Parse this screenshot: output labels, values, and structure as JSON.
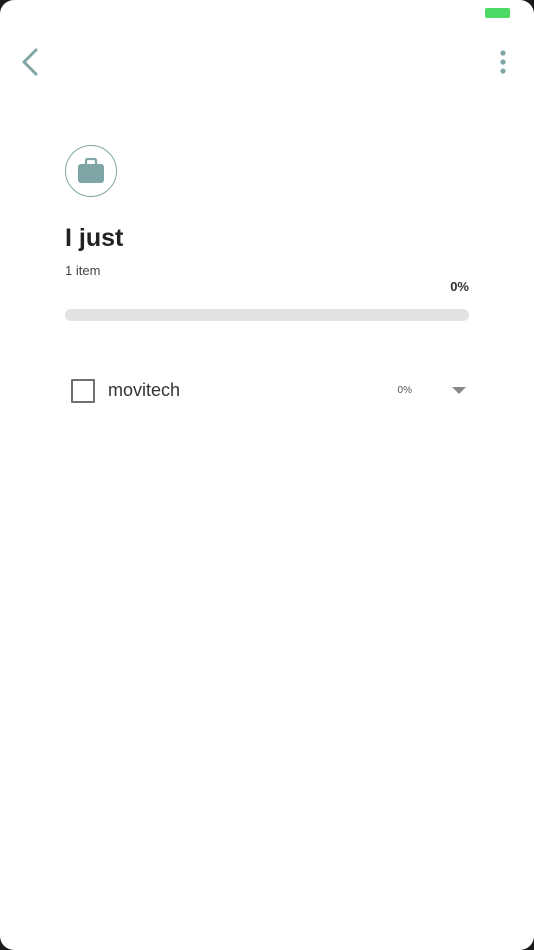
{
  "status_bar": {
    "battery_color": "#4cd964"
  },
  "header": {
    "back_icon": "chevron-left-icon",
    "more_icon": "more-vertical-icon"
  },
  "list": {
    "icon": "briefcase-icon",
    "accent_color": "#80a5a6",
    "title": "I just",
    "item_count": "1 item",
    "progress_label": "0%",
    "progress_fraction": 0
  },
  "items": [
    {
      "name": "movitech",
      "percent": "0%",
      "checked": false,
      "expand_icon": "caret-down-icon"
    }
  ]
}
